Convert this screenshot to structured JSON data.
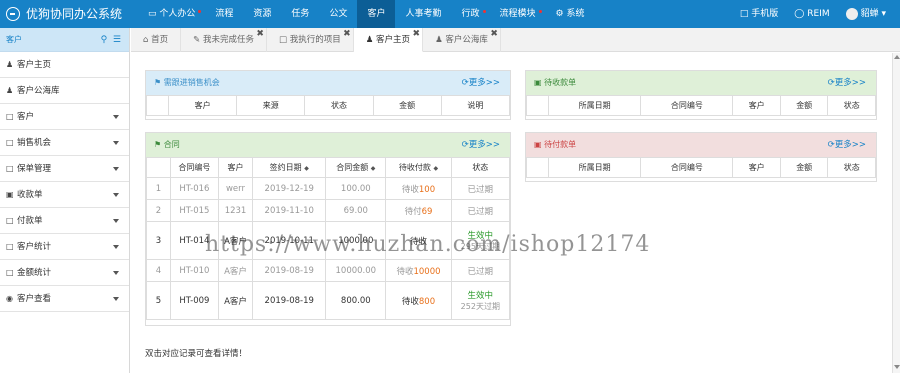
{
  "app": {
    "title": "优狗协同办公系统"
  },
  "nav": [
    {
      "label": "个人办公",
      "icon": "monitor-icon",
      "dot": true
    },
    {
      "label": "流程"
    },
    {
      "label": "资源"
    },
    {
      "label": "任务"
    },
    {
      "label": "公文"
    },
    {
      "label": "客户",
      "active": true
    },
    {
      "label": "人事考勤"
    },
    {
      "label": "行政",
      "dot": true
    },
    {
      "label": "流程模块",
      "dot": true
    },
    {
      "label": "系统",
      "icon": "gear-icon"
    }
  ],
  "nav_right": {
    "mobile": "手机版",
    "reim": "REIM",
    "user": "貂蝉"
  },
  "sidebar": {
    "header": "客户",
    "items": [
      {
        "label": "客户主页",
        "icon": "user-icon"
      },
      {
        "label": "客户公海库",
        "icon": "user-icon"
      },
      {
        "label": "客户",
        "icon": "bookmark-icon",
        "caret": true
      },
      {
        "label": "销售机会",
        "icon": "bookmark-icon",
        "caret": true
      },
      {
        "label": "保单管理",
        "icon": "bookmark-icon",
        "caret": true
      },
      {
        "label": "收款单",
        "icon": "money-icon",
        "caret": true
      },
      {
        "label": "付款单",
        "icon": "bookmark-icon",
        "caret": true
      },
      {
        "label": "客户统计",
        "icon": "bookmark-icon",
        "caret": true
      },
      {
        "label": "金额统计",
        "icon": "bookmark-icon",
        "caret": true
      },
      {
        "label": "客户查看",
        "icon": "eye-icon",
        "caret": true
      }
    ]
  },
  "tabs": [
    {
      "label": "首页",
      "icon": "home-icon"
    },
    {
      "label": "我未完成任务",
      "icon": "task-icon",
      "closable": true
    },
    {
      "label": "我执行的项目",
      "icon": "bookmark-icon",
      "closable": true
    },
    {
      "label": "客户主页",
      "icon": "user-icon",
      "closable": true,
      "active": true
    },
    {
      "label": "客户公海库",
      "icon": "user-icon",
      "closable": true
    }
  ],
  "panels": {
    "sales": {
      "title": "需跟进销售机会",
      "more": "更多>>",
      "columns": [
        "客户",
        "来源",
        "状态",
        "金额",
        "说明"
      ]
    },
    "receivable": {
      "title": "待收款单",
      "more": "更多>>",
      "columns": [
        "所属日期",
        "合同编号",
        "客户",
        "金额",
        "状态"
      ]
    },
    "contract": {
      "title": "合同",
      "more": "更多>>",
      "columns": [
        "合同编号",
        "客户",
        "签约日期",
        "合同金额",
        "待收付款",
        "状态"
      ],
      "rows": [
        {
          "no": "1",
          "code": "HT-016",
          "client": "werr",
          "date": "2019-12-19",
          "amount": "100.00",
          "pay_prefix": "待收",
          "pay_num": "100",
          "status": "已过期",
          "sub": ""
        },
        {
          "no": "2",
          "code": "HT-015",
          "client": "1231",
          "date": "2019-11-10",
          "amount": "69.00",
          "pay_prefix": "待付",
          "pay_num": "69",
          "status": "已过期",
          "sub": ""
        },
        {
          "no": "3",
          "code": "HT-014",
          "client": "A客户",
          "date": "2019-10-11",
          "amount": "1000.00",
          "pay_prefix": "待收",
          "pay_num": "",
          "status": "生效中",
          "sub": "295天过期"
        },
        {
          "no": "4",
          "code": "HT-010",
          "client": "A客户",
          "date": "2019-08-19",
          "amount": "10000.00",
          "pay_prefix": "待收",
          "pay_num": "10000",
          "status": "已过期",
          "sub": ""
        },
        {
          "no": "5",
          "code": "HT-009",
          "client": "A客户",
          "date": "2019-08-19",
          "amount": "800.00",
          "pay_prefix": "待收",
          "pay_num": "800",
          "status": "生效中",
          "sub": "252天过期"
        }
      ]
    },
    "payable": {
      "title": "待付款单",
      "more": "更多>>",
      "columns": [
        "所属日期",
        "合同编号",
        "客户",
        "金额",
        "状态"
      ]
    }
  },
  "footer_note": "双击对应记录可查看详情！",
  "watermark": "https://www.huzhan.com/ishop12174"
}
